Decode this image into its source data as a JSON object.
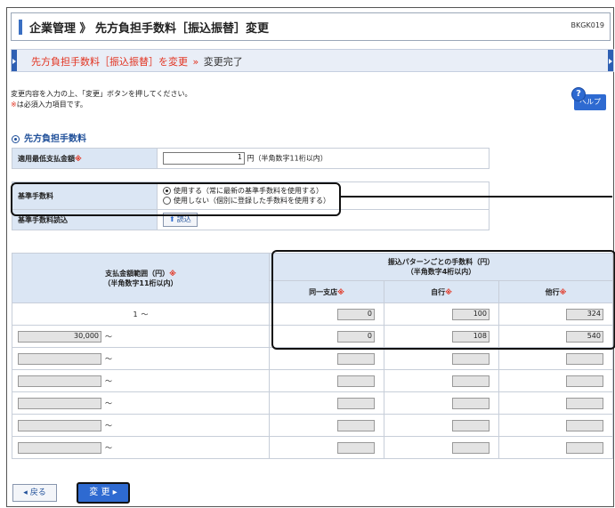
{
  "header": {
    "title": "企業管理 》 先方負担手数料［振込振替］変更",
    "screen_code": "BKGK019"
  },
  "steps": {
    "current": "先方負担手数料［振込振替］を変更",
    "separator": "»",
    "next": "変更完了"
  },
  "intro": {
    "line1": "変更内容を入力の上、「変更」ボタンを押してください。",
    "req_mark": "※",
    "line2": "は必須入力項目です。"
  },
  "help": {
    "label": "ヘルプ",
    "q": "?"
  },
  "section": {
    "title": "先方負担手数料"
  },
  "form": {
    "min_amount_label": "適用最低支払金額",
    "req": "※",
    "min_amount_value": "1",
    "min_amount_unit": "円（半角数字11桁以内）",
    "base_fee_label": "基準手数料",
    "option_use": "使用する（常に最新の基準手数料を使用する）",
    "option_nouse": "使用しない（個別に登録した手数料を使用する）",
    "base_fee_load_label": "基準手数料読込",
    "load_button": "読込"
  },
  "grid": {
    "range_header_line1": "支払金額範囲（円）",
    "range_header_line2": "（半角数字11桁以内）",
    "pattern_header_line1": "振込パターンごとの手数料（円）",
    "pattern_header_line2": "（半角数字4桁以内）",
    "col_same_branch": "同一支店",
    "col_own_bank": "自行",
    "col_other_bank": "他行",
    "req": "※",
    "tilde": "～",
    "rows": [
      {
        "from": "1",
        "same": "0",
        "own": "100",
        "other": "324"
      },
      {
        "from": "30,000",
        "same": "0",
        "own": "108",
        "other": "540"
      },
      {
        "from": "",
        "same": "",
        "own": "",
        "other": ""
      },
      {
        "from": "",
        "same": "",
        "own": "",
        "other": ""
      },
      {
        "from": "",
        "same": "",
        "own": "",
        "other": ""
      },
      {
        "from": "",
        "same": "",
        "own": "",
        "other": ""
      },
      {
        "from": "",
        "same": "",
        "own": "",
        "other": ""
      }
    ]
  },
  "buttons": {
    "back": "戻る",
    "change": "変 更"
  }
}
